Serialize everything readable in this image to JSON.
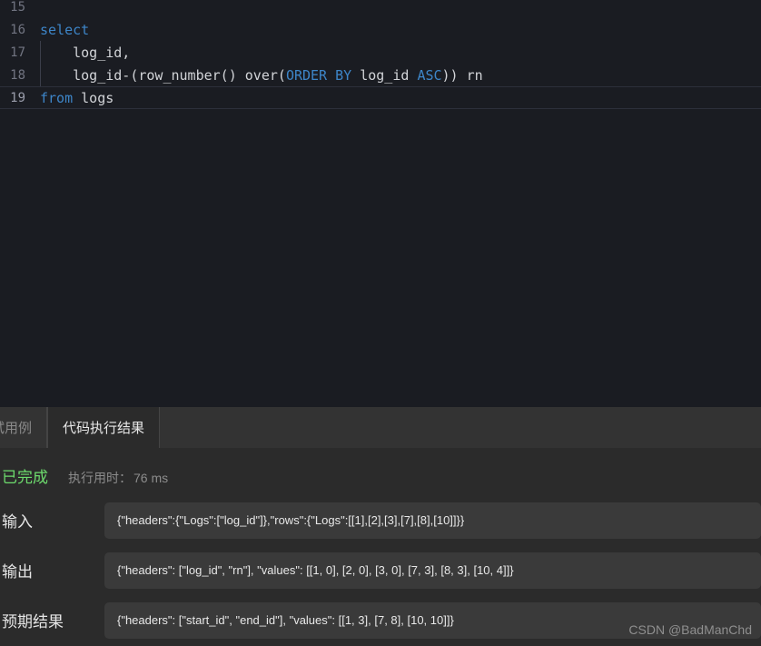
{
  "editor": {
    "lines": [
      {
        "number": "15",
        "tokens": [],
        "current": false,
        "indent_guide": false
      },
      {
        "number": "16",
        "tokens": [
          {
            "t": "select",
            "c": "kw"
          }
        ],
        "current": false,
        "indent_guide": false
      },
      {
        "number": "17",
        "tokens": [
          {
            "t": "    log_id,",
            "c": "txt"
          }
        ],
        "current": false,
        "indent_guide": true
      },
      {
        "number": "18",
        "tokens": [
          {
            "t": "    log_id-(row_number() over(",
            "c": "txt"
          },
          {
            "t": "ORDER BY",
            "c": "kw"
          },
          {
            "t": " log_id ",
            "c": "txt"
          },
          {
            "t": "ASC",
            "c": "kw"
          },
          {
            "t": ")) rn",
            "c": "txt"
          }
        ],
        "current": false,
        "indent_guide": true
      },
      {
        "number": "19",
        "tokens": [
          {
            "t": "from",
            "c": "kw"
          },
          {
            "t": " logs",
            "c": "txt"
          }
        ],
        "current": true,
        "indent_guide": false
      }
    ]
  },
  "result_panel": {
    "tabs": [
      {
        "label": "试用例",
        "active": false
      },
      {
        "label": "代码执行结果",
        "active": true
      }
    ],
    "status": {
      "text": "已完成",
      "color": "#6ddb6d",
      "time_label": "执行用时：",
      "time_value": "76 ms"
    },
    "io_rows": [
      {
        "label": "输入",
        "value": "{\"headers\":{\"Logs\":[\"log_id\"]},\"rows\":{\"Logs\":[[1],[2],[3],[7],[8],[10]]}}"
      },
      {
        "label": "输出",
        "value": "{\"headers\": [\"log_id\", \"rn\"], \"values\": [[1, 0], [2, 0], [3, 0], [7, 3], [8, 3], [10, 4]]}"
      },
      {
        "label": "预期结果",
        "value": "{\"headers\": [\"start_id\", \"end_id\"], \"values\": [[1, 3], [7, 8], [10, 10]]}"
      }
    ],
    "watermark": "CSDN @BadManChd"
  }
}
